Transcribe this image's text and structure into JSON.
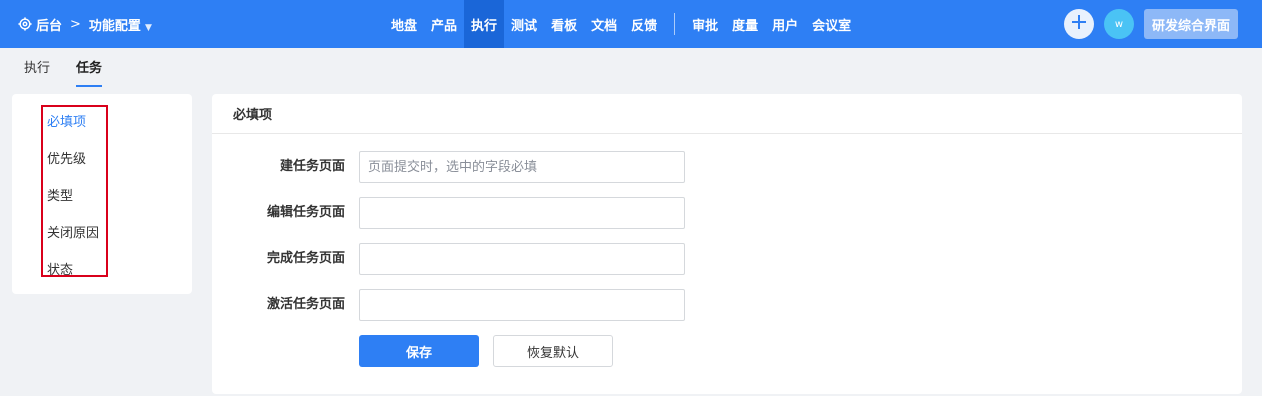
{
  "header": {
    "home_label": "后台",
    "breadcrumb_sep": ">",
    "section_label": "功能配置",
    "nav": [
      "地盘",
      "产品",
      "执行",
      "测试",
      "看板",
      "文档",
      "反馈",
      "审批",
      "度量",
      "用户",
      "会议室"
    ],
    "active_nav": "执行",
    "avatar_initial": "w",
    "workspace_label": "研发综合界面"
  },
  "subtabs": [
    {
      "label": "执行",
      "active": false
    },
    {
      "label": "任务",
      "active": true
    }
  ],
  "sidebar": {
    "items": [
      {
        "label": "必填项",
        "active": true
      },
      {
        "label": "优先级",
        "active": false
      },
      {
        "label": "类型",
        "active": false
      },
      {
        "label": "关闭原因",
        "active": false
      },
      {
        "label": "状态",
        "active": false
      }
    ]
  },
  "panel": {
    "title": "必填项",
    "fields": [
      {
        "label": "建任务页面",
        "value": "",
        "placeholder": "页面提交时，选中的字段必填"
      },
      {
        "label": "编辑任务页面",
        "value": "",
        "placeholder": ""
      },
      {
        "label": "完成任务页面",
        "value": "",
        "placeholder": ""
      },
      {
        "label": "激活任务页面",
        "value": "",
        "placeholder": ""
      }
    ],
    "save_label": "保存",
    "reset_label": "恢复默认"
  },
  "colors": {
    "primary": "#2e7ff4",
    "active_nav_bg": "#1a66d8",
    "highlight_box": "#d9001b"
  }
}
